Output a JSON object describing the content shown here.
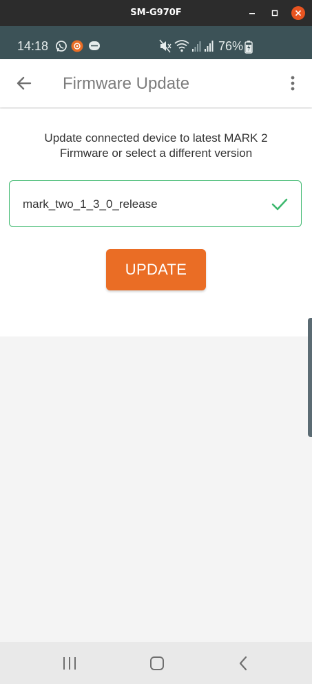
{
  "window": {
    "title": "SM-G970F",
    "icons": [
      "minimize-icon",
      "maximize-icon",
      "close-icon"
    ]
  },
  "status_bar": {
    "time": "14:18",
    "battery_percent": "76%",
    "left_icons": [
      "whatsapp-icon",
      "orange-app-icon",
      "chat-bubble-icon"
    ],
    "right_icons": [
      "mute-icon",
      "wifi-icon",
      "signal-icon",
      "signal-icon",
      "battery-charging-icon"
    ]
  },
  "app_bar": {
    "title": "Firmware Update",
    "back_icon": "arrow-left-icon",
    "menu_icon": "more-vert-icon"
  },
  "content": {
    "description_line1": "Update connected device to latest MARK 2",
    "description_line2": "Firmware or select a different version",
    "selected_version": "mark_two_1_3_0_release",
    "selected_icon": "check-icon",
    "update_button_label": "UPDATE"
  },
  "nav_bar": {
    "icons": [
      "recents-icon",
      "home-icon",
      "back-icon"
    ]
  },
  "colors": {
    "status_bar": "#3c5257",
    "accent_orange": "#ea6d25",
    "success_green": "#3db86e",
    "title_gray": "#7c7c7c",
    "window_close": "#e95420"
  }
}
